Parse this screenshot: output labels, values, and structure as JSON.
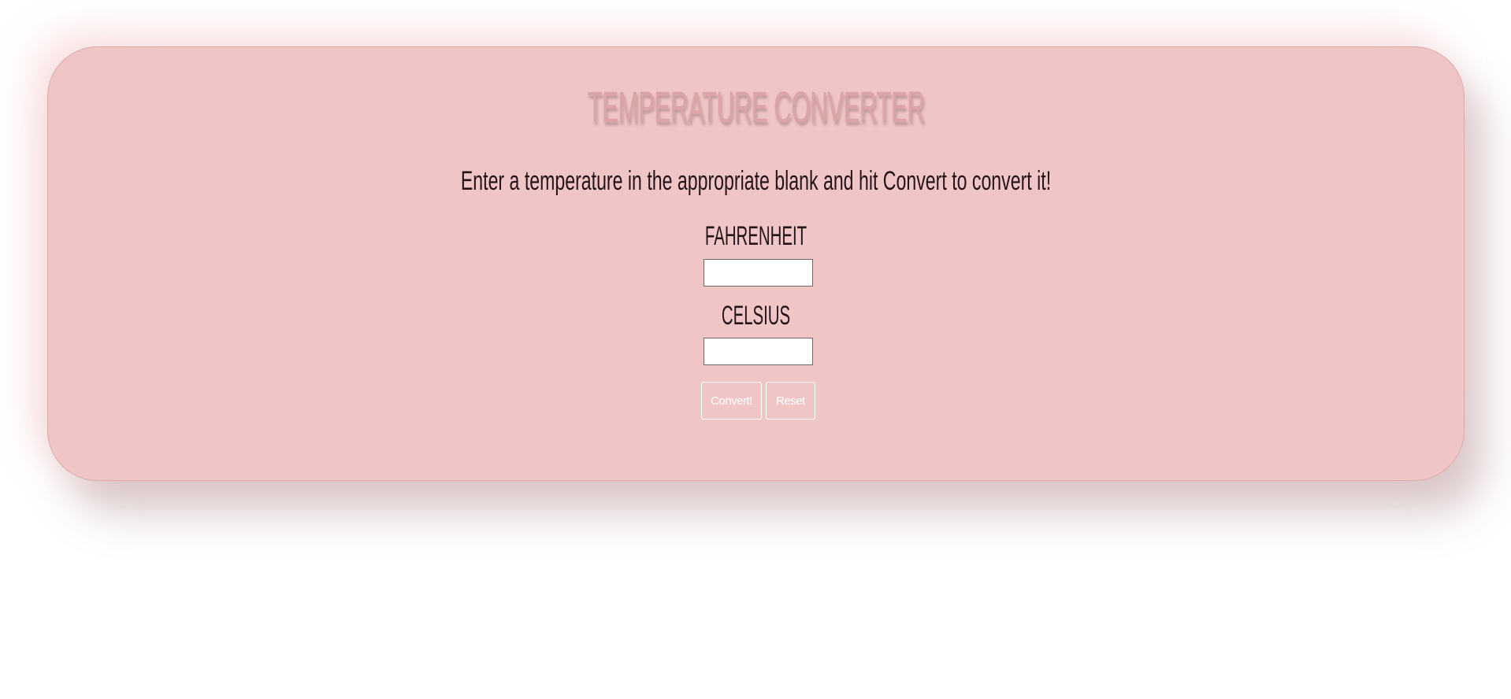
{
  "converter": {
    "title": "Temperature Converter",
    "instructions": "Enter a temperature in the appropriate blank and hit Convert to convert it!",
    "fahrenheit_label": "Fahrenheit",
    "fahrenheit_value": "",
    "celsius_label": "Celsius",
    "celsius_value": "",
    "convert_label": "Convert!",
    "reset_label": "Reset"
  },
  "colors": {
    "card_background": "#efc5c6",
    "title_color": "#dca4a7",
    "text_color": "#24141a",
    "button_text": "#ffffff"
  }
}
